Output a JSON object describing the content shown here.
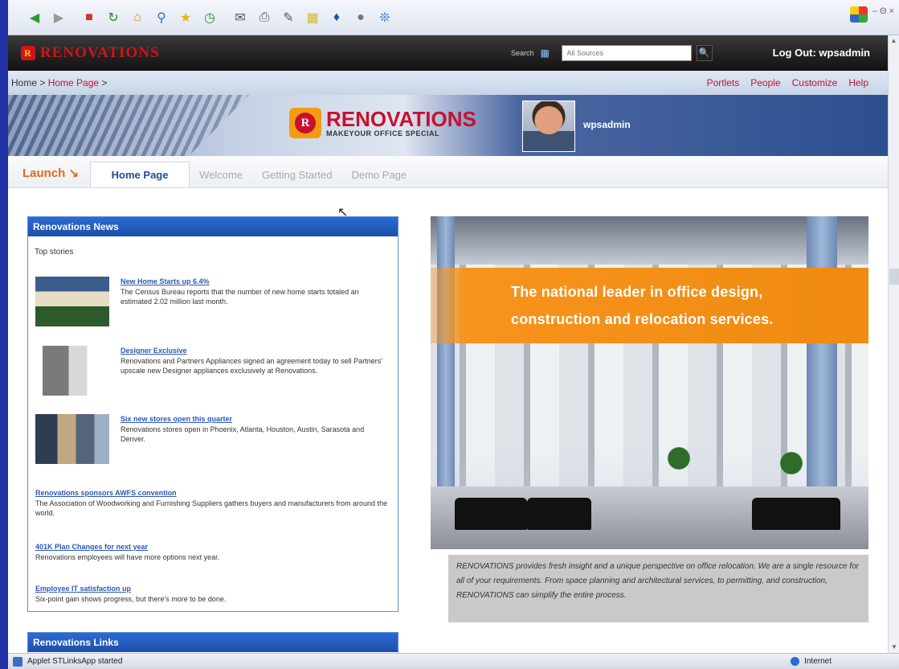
{
  "browser": {
    "toolbar_icons": [
      "back-icon",
      "forward-icon",
      "stop-icon",
      "refresh-icon",
      "home-icon",
      "search-icon",
      "favorites-icon",
      "history-icon",
      "mail-icon",
      "print-icon",
      "edit-icon",
      "folder-icon",
      "bluetooth-icon",
      "messenger-icon",
      "extension-icon"
    ],
    "window_controls": "– Θ ×",
    "status_text": "Applet STLinksApp started",
    "zone_text": "Internet"
  },
  "portal": {
    "brand": "RENOVATIONS",
    "search": {
      "label": "Search",
      "placeholder": "All Sources",
      "go_icon": "🔍"
    },
    "logout": "Log Out: wpsadmin",
    "breadcrumb": {
      "home": "Home",
      "sep": " > ",
      "current": "Home Page",
      "trail": " >"
    },
    "nav_links": [
      "Portlets",
      "People",
      "Customize",
      "Help"
    ],
    "banner": {
      "logo_letter": "R",
      "logo_name": "RENOVATIONS",
      "logo_tagline": "MAKEYOUR OFFICE SPECIAL",
      "user": "wpsadmin"
    },
    "launch": "Launch ↘",
    "tabs": [
      "Home Page",
      "Welcome",
      "Getting Started",
      "Demo Page"
    ]
  },
  "news": {
    "title": "Renovations News",
    "top_stories": "Top stories",
    "stories": [
      {
        "link": "New Home Starts up 6.4%",
        "text": "The Census Bureau reports that the number of new home starts totaled an estimated 2.02 million last month."
      },
      {
        "link": "Designer Exclusive",
        "text": "Renovations and Partners Appliances signed an agreement today to sell Partners' upscale new Designer appliances exclusively at Renovations."
      },
      {
        "link": "Six new stores open this quarter",
        "text": "Renovations stores open in Phoenix, Atlanta, Houston, Austin, Sarasota and Denver."
      },
      {
        "link": "Renovations sponsors AWFS convention",
        "text": "The Association of Woodworking and Furnishing Suppliers gathers buyers and manufacturers from around the world."
      },
      {
        "link": "401K Plan Changes for next year",
        "text": "Renovations employees will have more options next year."
      },
      {
        "link": "Employee IT satisfaction up",
        "text": "Six-point gain shows progress, but there's more to be done."
      }
    ]
  },
  "links_portlet": {
    "title": "Renovations Links"
  },
  "hero": {
    "line1": "The national leader in office design,",
    "line2": "construction and relocation services.",
    "caption": "RENOVATIONS provides fresh insight and a unique perspective on office relocation. We are a single resource for all of your requirements. From space planning and architectural services, to permitting, and construction, RENOVATIONS can simplify the entire process."
  },
  "colors": {
    "brand_red": "#c8102e",
    "accent_orange": "#f7941d",
    "portlet_blue": "#2c6bd4"
  }
}
